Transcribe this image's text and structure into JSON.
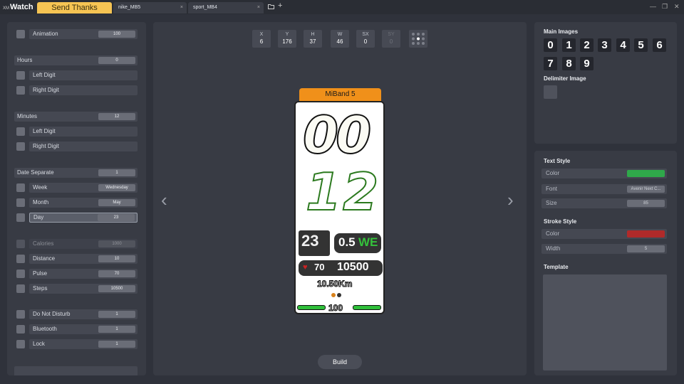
{
  "titlebar": {
    "brand_small": "XM",
    "brand": "Watch",
    "send_thanks": "Send Thanks",
    "tabs": [
      {
        "label": "nike_MB5",
        "close": "×"
      },
      {
        "label": "sport_MB4",
        "close": "×"
      }
    ],
    "window_controls": [
      "—",
      "❐",
      "✕"
    ]
  },
  "left": {
    "animation": {
      "label": "Animation",
      "value": "100"
    },
    "hours": {
      "label": "Hours",
      "value": "0",
      "left": "Left Digit",
      "right": "Right Digit"
    },
    "minutes": {
      "label": "Minutes",
      "value": "12",
      "left": "Left Digit",
      "right": "Right Digit"
    },
    "date_separate": {
      "label": "Date Separate",
      "value": "1"
    },
    "week": {
      "label": "Week",
      "value": "Wednesday"
    },
    "month": {
      "label": "Month",
      "value": "May"
    },
    "day": {
      "label": "Day",
      "value": "23"
    },
    "calories": {
      "label": "Calories",
      "value": "1000"
    },
    "distance": {
      "label": "Distance",
      "value": "10"
    },
    "pulse": {
      "label": "Pulse",
      "value": "70"
    },
    "steps": {
      "label": "Steps",
      "value": "10500"
    },
    "dnd": {
      "label": "Do Not Disturb",
      "value": "1"
    },
    "bluetooth": {
      "label": "Bluetooth",
      "value": "1"
    },
    "lock": {
      "label": "Lock",
      "value": "1"
    }
  },
  "center": {
    "stats": [
      {
        "key": "X",
        "value": "6"
      },
      {
        "key": "Y",
        "value": "176"
      },
      {
        "key": "H",
        "value": "37"
      },
      {
        "key": "W",
        "value": "46"
      },
      {
        "key": "SX",
        "value": "0"
      },
      {
        "key": "SY",
        "value": "0"
      }
    ],
    "device_label": "MiBand 5",
    "build_label": "Build",
    "prev_arrow": "‹",
    "next_arrow": "›",
    "preview": {
      "hours": "00",
      "minutes": "12",
      "day": "23",
      "month_week": "0.5",
      "week_abbr": "WE",
      "pulse": "70",
      "steps": "10500",
      "distance": "10.50Km",
      "battery": "100"
    }
  },
  "right": {
    "main_images_label": "Main Images",
    "digits": [
      "0",
      "1",
      "2",
      "3",
      "4",
      "5",
      "6",
      "7",
      "8",
      "9"
    ],
    "delimiter_label": "Delimiter Image",
    "text_style_label": "Text Style",
    "text_color_label": "Color",
    "text_color": "#2fa84a",
    "font_label": "Font",
    "font_value": "Avenir Next C...",
    "size_label": "Size",
    "size_value": "85",
    "stroke_style_label": "Stroke Style",
    "stroke_color_label": "Color",
    "stroke_color": "#b02a2a",
    "width_label": "Width",
    "width_value": "5",
    "template_label": "Template"
  }
}
